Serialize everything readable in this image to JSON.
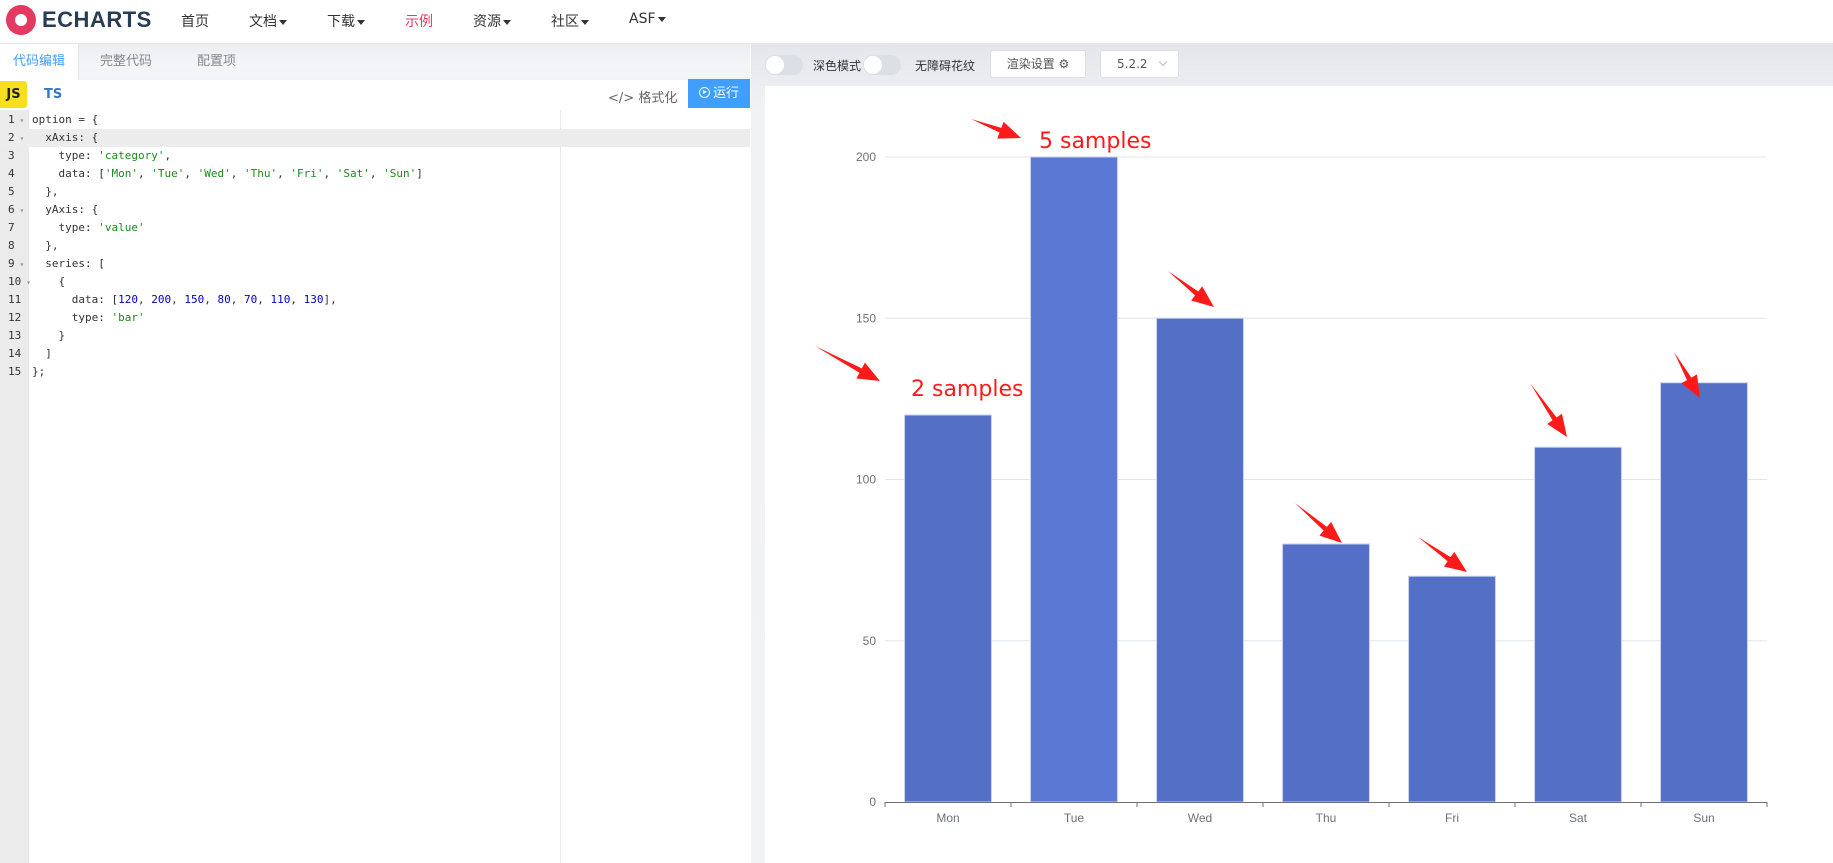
{
  "nav": {
    "logo_text": "ECHARTS",
    "items": [
      {
        "label": "首页",
        "dropdown": false,
        "active": false
      },
      {
        "label": "文档",
        "dropdown": true,
        "active": false
      },
      {
        "label": "下载",
        "dropdown": true,
        "active": false
      },
      {
        "label": "示例",
        "dropdown": false,
        "active": true
      },
      {
        "label": "资源",
        "dropdown": true,
        "active": false
      },
      {
        "label": "社区",
        "dropdown": true,
        "active": false
      },
      {
        "label": "ASF",
        "dropdown": true,
        "active": false
      }
    ]
  },
  "editor_tabs": [
    {
      "label": "代码编辑",
      "active": true
    },
    {
      "label": "完整代码",
      "active": false
    },
    {
      "label": "配置项",
      "active": false
    }
  ],
  "lang": {
    "js": "JS",
    "ts": "TS"
  },
  "format_label": "格式化",
  "run_label": "运行",
  "code_lines": [
    {
      "n": "1",
      "fold": true,
      "text": "option = {"
    },
    {
      "n": "2",
      "fold": true,
      "text": "  xAxis: {"
    },
    {
      "n": "3",
      "fold": false,
      "text": "    type: 'category',"
    },
    {
      "n": "4",
      "fold": false,
      "text": "    data: ['Mon', 'Tue', 'Wed', 'Thu', 'Fri', 'Sat', 'Sun']"
    },
    {
      "n": "5",
      "fold": false,
      "text": "  },"
    },
    {
      "n": "6",
      "fold": true,
      "text": "  yAxis: {"
    },
    {
      "n": "7",
      "fold": false,
      "text": "    type: 'value'"
    },
    {
      "n": "8",
      "fold": false,
      "text": "  },"
    },
    {
      "n": "9",
      "fold": true,
      "text": "  series: ["
    },
    {
      "n": "10",
      "fold": true,
      "text": "    {"
    },
    {
      "n": "11",
      "fold": false,
      "text": "      data: [120, 200, 150, 80, 70, 110, 130],"
    },
    {
      "n": "12",
      "fold": false,
      "text": "      type: 'bar'"
    },
    {
      "n": "13",
      "fold": false,
      "text": "    }"
    },
    {
      "n": "14",
      "fold": false,
      "text": "  ]"
    },
    {
      "n": "15",
      "fold": false,
      "text": "};"
    }
  ],
  "active_line": 2,
  "toolbar": {
    "dark_mode_label": "深色模式",
    "dark_mode_on": false,
    "decal_label": "无障碍花纹",
    "decal_on": false,
    "render_settings_label": "渲染设置",
    "version": "5.2.2"
  },
  "colors": {
    "bar": "#5470c6",
    "bar_hover": "#5b78d4",
    "annotation": "#ff1a1a",
    "accent": "#409eff",
    "brand": "#e43961"
  },
  "chart_data": {
    "type": "bar",
    "categories": [
      "Mon",
      "Tue",
      "Wed",
      "Thu",
      "Fri",
      "Sat",
      "Sun"
    ],
    "values": [
      120,
      200,
      150,
      80,
      70,
      110,
      130
    ],
    "highlighted_category": "Tue",
    "yticks": [
      0,
      50,
      100,
      150,
      200
    ],
    "ylim": [
      0,
      200
    ],
    "grid": true,
    "title": "",
    "xlabel": "",
    "ylabel": "",
    "annotations": [
      {
        "text": "2 samples",
        "target": "Mon"
      },
      {
        "text": "5 samples",
        "target": "Tue"
      },
      {
        "text": "",
        "target": "Wed"
      },
      {
        "text": "",
        "target": "Thu"
      },
      {
        "text": "",
        "target": "Fri"
      },
      {
        "text": "",
        "target": "Sat"
      },
      {
        "text": "",
        "target": "Sun"
      }
    ]
  }
}
